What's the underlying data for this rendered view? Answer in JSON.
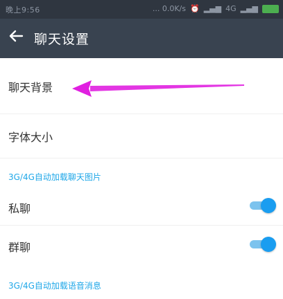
{
  "status_bar": {
    "time": "晚上9:56",
    "network_speed": "... 0.0K/s",
    "signal_text": "4G"
  },
  "toolbar": {
    "back_icon": "arrow-left-icon",
    "title": "聊天设置"
  },
  "settings": {
    "chat_background": "聊天背景",
    "font_size": "字体大小",
    "auto_load_images_header": "3G/4G自动加载聊天图片",
    "private_chat": {
      "label": "私聊",
      "enabled": true
    },
    "group_chat": {
      "label": "群聊",
      "enabled": true
    },
    "auto_load_voice_header": "3G/4G自动加载语音消息"
  },
  "colors": {
    "toolbar_bg": "#394350",
    "status_bg": "#2f3640",
    "accent_blue": "#1a9df0",
    "section_blue": "#1fa7e8",
    "annotation_magenta": "#e020e0"
  }
}
